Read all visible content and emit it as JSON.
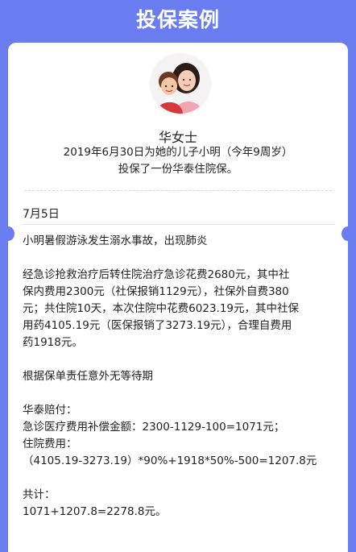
{
  "header": {
    "title": "投保案例"
  },
  "card": {
    "avatar_icon": "mother-and-son-photo-icon",
    "name": "华女士",
    "intro_line1": "2019年6月30日为她的儿子小明（今年9周岁）",
    "intro_line2": "投保了一份华泰住院保。",
    "date": "7月5日",
    "event": "小明暑假游泳发生溺水事故，出现肺炎",
    "details": [
      "经急诊抢救治疗后转住院治疗急诊花费2680元，其中社",
      "保内费用2300元（社保报销1129元），社保外自费380",
      "元；共住院10天，本次住院中花费6023.19元，其中社保",
      "用药4105.19元（医保报销了3273.19元），合理自费用",
      "药1918元。"
    ],
    "policy_note": "根据保单责任意外无等待期",
    "payout_title": "华泰赔付：",
    "emergency_payout": "急诊医疗费用补偿金额：2300-1129-100=1071元；",
    "hospital_label": "住院费用：",
    "hospital_calc": "（4105.19-3273.19）*90%+1918*50%-500=1207.8元",
    "total_label": "共计：",
    "total_calc": "1071+1207.8=2278.8元。"
  },
  "colors": {
    "background": "#6a7df0",
    "card": "#ffffff",
    "text": "#222222"
  }
}
